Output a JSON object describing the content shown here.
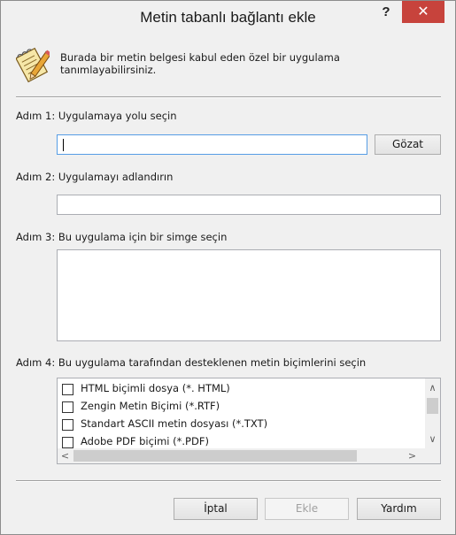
{
  "window": {
    "title": "Metin tabanlı bağlantı ekle",
    "help_label": "?",
    "close_label": "✕"
  },
  "info": {
    "icon": "notepad-pencil-icon",
    "text": "Burada bir metin belgesi kabul eden özel bir uygulama tanımlayabilirsiniz."
  },
  "step1": {
    "label": "Adım 1: Uygulamaya yolu seçin",
    "path_value": "",
    "browse_label": "Gözat"
  },
  "step2": {
    "label": "Adım 2: Uygulamayı adlandırın",
    "name_value": ""
  },
  "step3": {
    "label": "Adım 3: Bu uygulama için bir simge seçin"
  },
  "step4": {
    "label": "Adım 4: Bu uygulama tarafından desteklenen metin biçimlerini seçin",
    "formats": [
      {
        "label": "HTML biçimli dosya (*. HTML)",
        "checked": false
      },
      {
        "label": "Zengin Metin Biçimi (*.RTF)",
        "checked": false
      },
      {
        "label": "Standart ASCII metin dosyası (*.TXT)",
        "checked": false
      },
      {
        "label": "Adobe PDF biçimi (*.PDF)",
        "checked": false
      }
    ]
  },
  "footer": {
    "cancel_label": "İptal",
    "add_label": "Ekle",
    "help_label": "Yardım"
  },
  "colors": {
    "close_button": "#c7433c",
    "focus_border": "#569de5"
  }
}
